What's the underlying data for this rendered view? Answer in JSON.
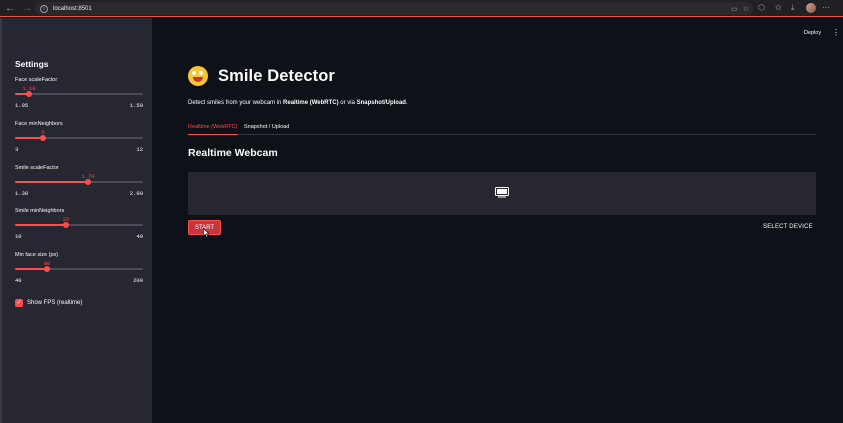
{
  "browser": {
    "url": "localhost:8501"
  },
  "header": {
    "deploy_label": "Deploy"
  },
  "sidebar": {
    "title": "Settings",
    "sliders": [
      {
        "label": "Face scaleFactor",
        "value": "1.10",
        "min": "1.05",
        "max": "1.50",
        "fraction": 0.11
      },
      {
        "label": "Face minNeighbors",
        "value": "5",
        "min": "3",
        "max": "12",
        "fraction": 0.22
      },
      {
        "label": "Smile scaleFactor",
        "value": "1.70",
        "min": "1.30",
        "max": "2.00",
        "fraction": 0.57
      },
      {
        "label": "Smile minNeighbors",
        "value": "22",
        "min": "10",
        "max": "40",
        "fraction": 0.4
      },
      {
        "label": "Min face size (px)",
        "value": "80",
        "min": "40",
        "max": "200",
        "fraction": 0.25
      }
    ],
    "show_fps_label": "Show FPS (realtime)",
    "show_fps_checked": true
  },
  "main": {
    "title": "Smile Detector",
    "subtitle_prefix": "Detect smiles from your webcam in ",
    "subtitle_bold1": "Realtime (WebRTC)",
    "subtitle_mid": " or via ",
    "subtitle_bold2": "Snapshot/Upload",
    "subtitle_suffix": ".",
    "tabs": [
      {
        "label": "Realtime (WebRTC)",
        "active": true
      },
      {
        "label": "Snapshot / Upload",
        "active": false
      }
    ],
    "section_title": "Realtime Webcam",
    "start_label": "START",
    "select_device_label": "SELECT DEVICE"
  },
  "colors": {
    "accent": "#ff4b4b",
    "background": "#0e1117",
    "sidebar": "#262730"
  }
}
